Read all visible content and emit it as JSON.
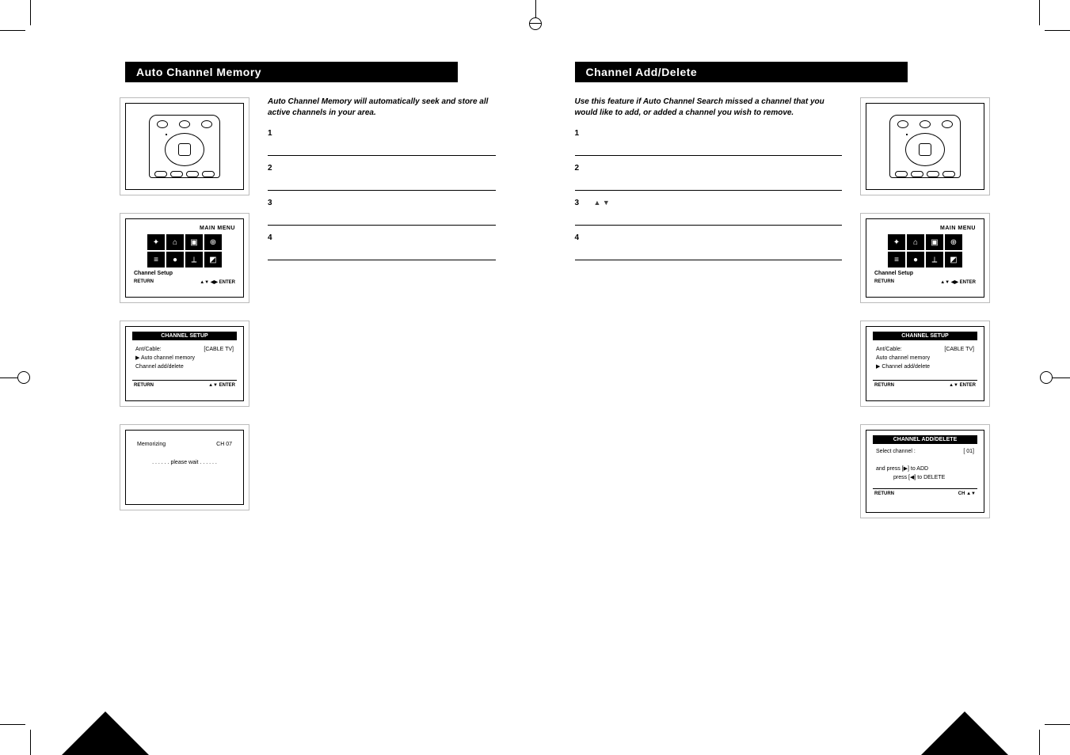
{
  "left": {
    "heading": "Auto Channel Memory",
    "intro": "Auto Channel Memory will automatically seek and store all active channels in your area.",
    "steps": [
      {
        "num": "1",
        "text": " "
      },
      {
        "num": "2",
        "text": " "
      },
      {
        "num": "3",
        "text": " "
      },
      {
        "num": "4",
        "text": " "
      }
    ],
    "menu_title": "MAIN MENU",
    "menu_sub": "Channel Setup",
    "menu_return": "RETURN",
    "menu_enter": "▲▼ ◀▶  ENTER",
    "setup_title": "CHANNEL SETUP",
    "setup_rows": [
      {
        "l": "Ant/Cable:",
        "r": "[CABLE TV]"
      },
      {
        "l": "▶ Auto channel memory",
        "r": ""
      },
      {
        "l": "Channel add/delete",
        "r": ""
      }
    ],
    "setup_return": "RETURN",
    "setup_enter": "▲▼  ENTER",
    "mem_label": "Memorizing",
    "mem_ch": "CH 07",
    "mem_wait": ". . . . . . please wait . . . . . ."
  },
  "right": {
    "heading": "Channel Add/Delete",
    "intro": "Use this feature if Auto Channel Search missed a channel that you would like to add, or added a channel you wish to remove.",
    "steps": [
      {
        "num": "1",
        "text": " "
      },
      {
        "num": "2",
        "text": " "
      },
      {
        "num": "3",
        "text": "▲ ▼"
      },
      {
        "num": "4",
        "text": " "
      }
    ],
    "menu_title": "MAIN MENU",
    "menu_sub": "Channel Setup",
    "menu_return": "RETURN",
    "menu_enter": "▲▼ ◀▶  ENTER",
    "setup_title": "CHANNEL SETUP",
    "setup_rows": [
      {
        "l": "Ant/Cable:",
        "r": "[CABLE TV]"
      },
      {
        "l": "Auto channel memory",
        "r": ""
      },
      {
        "l": "▶ Channel add/delete",
        "r": ""
      }
    ],
    "setup_return": "RETURN",
    "setup_enter": "▲▼  ENTER",
    "ad_title": "CHANNEL ADD/DELETE",
    "ad_select": "Select channel  :",
    "ad_select_val": "[ 01]",
    "ad_press1": "and  press  [▶]  to   ADD",
    "ad_press2": "press  [◀]  to   DELETE",
    "ad_return": "RETURN",
    "ad_ch": "CH ▲▼"
  }
}
